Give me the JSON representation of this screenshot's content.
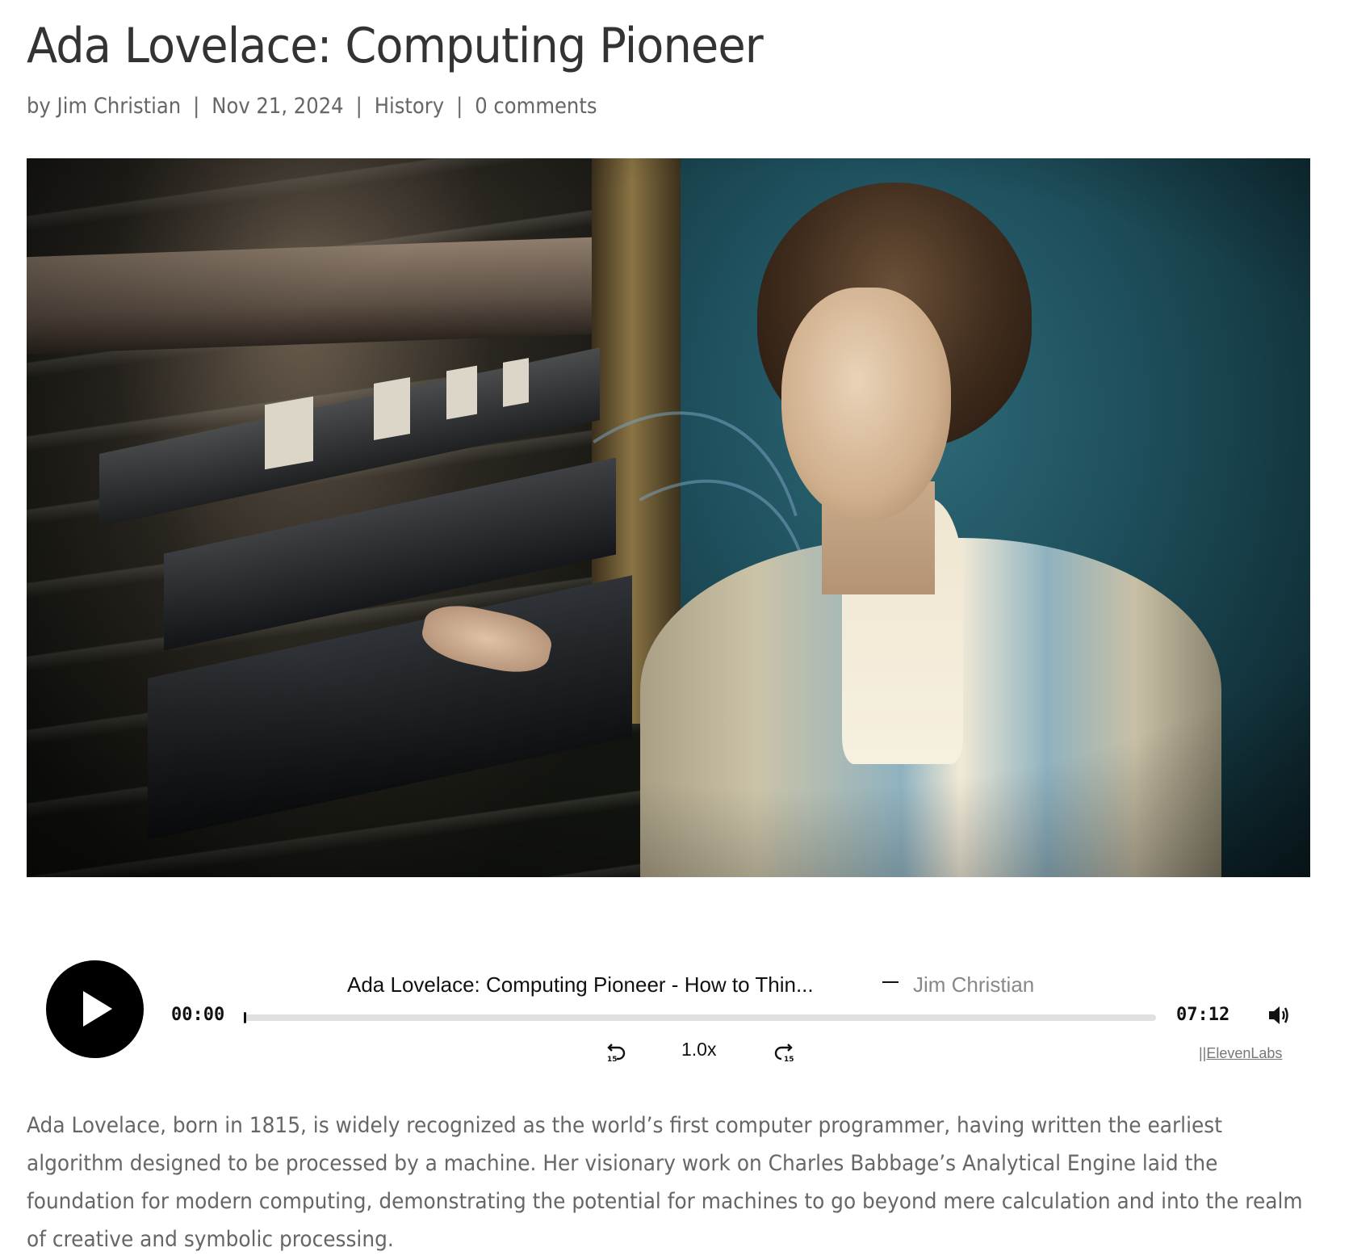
{
  "article": {
    "title": "Ada Lovelace: Computing Pioneer",
    "meta": {
      "author_prefix": "by",
      "author": "Jim Christian",
      "date": "Nov 21, 2024",
      "category": "History",
      "comments": "0 comments",
      "separator": "|"
    },
    "hero_image": {
      "description": "Woman in Victorian dress operating a vintage patch-panel computing machine with cables",
      "icon": "photo"
    },
    "body": "Ada Lovelace, born in 1815, is widely recognized as the world’s first computer programmer, having written the earliest algorithm designed to be processed by a machine. Her visionary work on Charles Babbage’s Analytical Engine laid the foundation for modern computing, demonstrating the potential for machines to go beyond mere calculation and into the realm of creative and symbolic processing."
  },
  "player": {
    "track_title": "Ada Lovelace: Computing Pioneer - How to Thin...",
    "author": "Jim Christian",
    "current_time": "00:00",
    "duration": "07:12",
    "progress_fraction": 0,
    "speed": "1.0x",
    "rewind_seconds": "15",
    "forward_seconds": "15",
    "brand_prefix": "||",
    "brand": "ElevenLabs",
    "icons": {
      "play": "play-icon",
      "volume": "volume-icon",
      "rewind": "rewind-15-icon",
      "forward": "forward-15-icon"
    }
  }
}
